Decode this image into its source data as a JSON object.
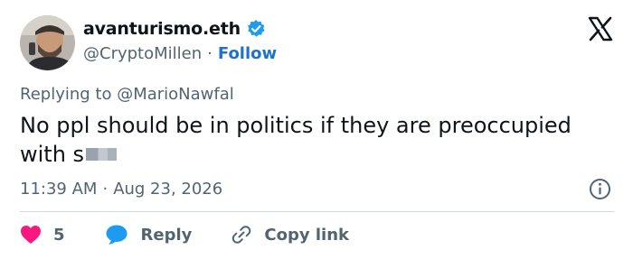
{
  "author": {
    "display_name": "avanturismo.eth",
    "handle": "@CryptoMillen",
    "separator": "·",
    "follow_label": "Follow"
  },
  "reply": {
    "prefix": "Replying to ",
    "mention": "@MarioNawfal"
  },
  "tweet": {
    "text": "No ppl should be in politics if they are preoccupied with s"
  },
  "meta": {
    "time": "11:39 AM",
    "separator": "·",
    "date": "Aug 23, 2026"
  },
  "actions": {
    "like_count": "5",
    "reply_label": "Reply",
    "copy_label": "Copy link"
  },
  "colors": {
    "text": "#0f1419",
    "secondary": "#536471",
    "link": "#1d73c9",
    "verified": "#1d9bf0",
    "like": "#f91880",
    "reply_bubble": "#1d9bf0",
    "divider": "#cfd9de"
  },
  "icons": [
    "verified-badge-icon",
    "x-logo-icon",
    "info-icon",
    "heart-icon",
    "reply-bubble-icon",
    "link-icon"
  ]
}
